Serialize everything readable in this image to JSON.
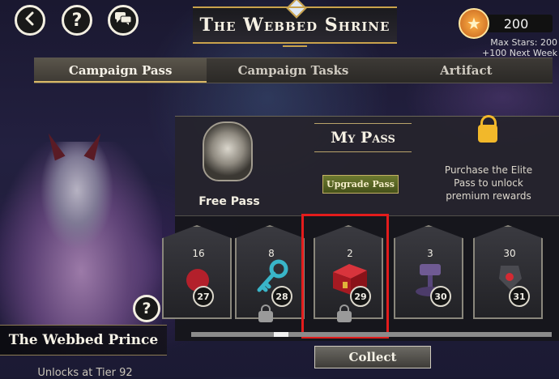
{
  "header": {
    "title": "The Webbed Shrine",
    "back_icon": "back-arrow-icon",
    "help_symbol": "?",
    "chat_icon": "chat-bubbles-icon"
  },
  "stars": {
    "count": "200",
    "max_line": "Max Stars: 200",
    "next_line": "+100 Next Week"
  },
  "tabs": [
    {
      "label": "Campaign Pass",
      "active": true
    },
    {
      "label": "Campaign Tasks",
      "active": false
    },
    {
      "label": "Artifact",
      "active": false
    }
  ],
  "pass": {
    "free_label": "Free Pass",
    "my_pass_title": "My Pass",
    "upgrade_label": "Upgrade Pass",
    "elite_text": "Purchase the Elite Pass to unlock premium rewards"
  },
  "rewards": [
    {
      "qty": "16",
      "tier": "27",
      "locked": false
    },
    {
      "qty": "8",
      "tier": "28",
      "locked": true
    },
    {
      "qty": "2",
      "tier": "29",
      "locked": true,
      "highlighted": true
    },
    {
      "qty": "3",
      "tier": "30",
      "locked": false
    },
    {
      "qty": "30",
      "tier": "31",
      "locked": false
    }
  ],
  "scroll_position": 0.23,
  "collect_label": "Collect",
  "hero": {
    "name": "The Webbed Prince",
    "unlock_text": "Unlocks at Tier 92",
    "help_symbol": "?"
  },
  "colors": {
    "gold_trim": "#c9a24c",
    "highlight_red": "#e31c1c",
    "upgrade_green": "#5a6a25"
  }
}
